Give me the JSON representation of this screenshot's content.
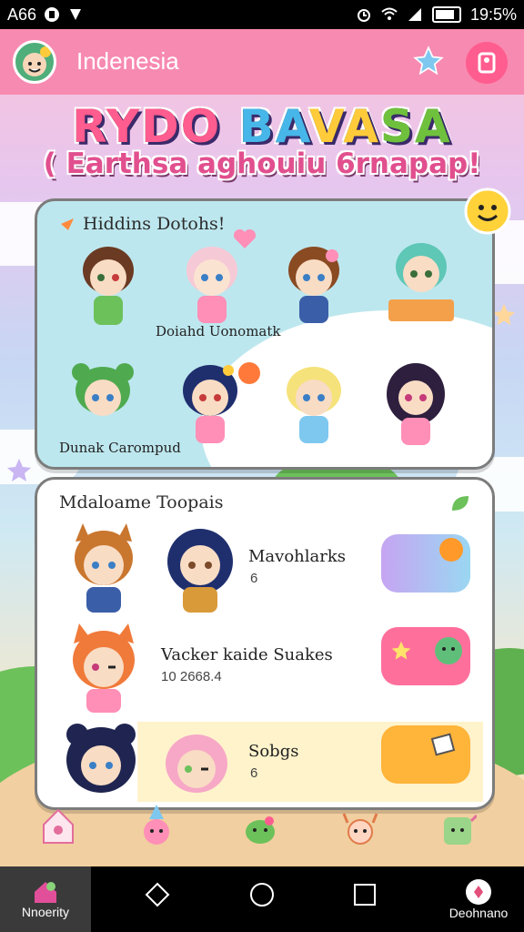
{
  "status_bar": {
    "left_text": "A66",
    "time": "19:5%"
  },
  "app": {
    "title": "Indenesia",
    "banner_title_parts": [
      "RYDO",
      "BA",
      "VA",
      "SA"
    ],
    "banner_subtitle": "( Earthsa aghouiu 6rnapap!"
  },
  "card1": {
    "title": "Hiddins Dotohs!",
    "label_1": "Doiahd Uonomatk",
    "label_2": "Dunak Carompud"
  },
  "card2": {
    "title": "Mdaloame Toopais",
    "rows": [
      {
        "title": "Mavohlarks",
        "meta": "6"
      },
      {
        "title": "Vacker kaide Suakes",
        "meta": "10 2668.4"
      },
      {
        "title": "Sobgs",
        "meta": "6"
      }
    ]
  },
  "nav": {
    "left_label": "Nnoerity",
    "right_label": "Deohnano"
  },
  "colors": {
    "header_pink": "#f78ab0",
    "accent_pink": "#ff5c8f",
    "card_blue": "#bde7ee"
  },
  "icons": [
    "logo-icon",
    "star-icon",
    "profile-icon",
    "sparkle-icon",
    "leaf-icon",
    "home-icon",
    "back-icon",
    "home-circle-icon",
    "recents-icon",
    "app-icon"
  ]
}
